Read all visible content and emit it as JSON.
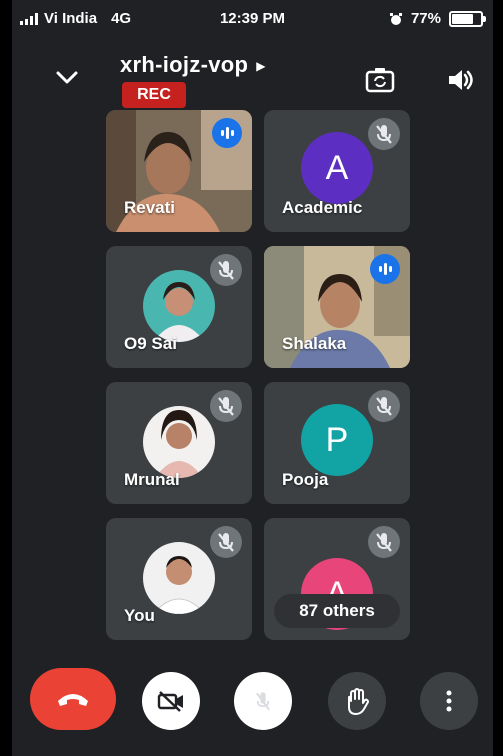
{
  "status_bar": {
    "carrier": "Vi India",
    "network": "4G",
    "time": "12:39 PM",
    "battery": "77%"
  },
  "meeting": {
    "code": "xrh-iojz-vop",
    "recording_label": "REC"
  },
  "participants": [
    {
      "name": "Revati",
      "tile": "video",
      "mic": "speaking"
    },
    {
      "name": "Academic",
      "tile": "avatar",
      "initial": "A",
      "avatar_color": "#5c2fc2",
      "mic": "muted"
    },
    {
      "name": "O9 Sai",
      "tile": "photo",
      "mic": "muted"
    },
    {
      "name": "Shalaka",
      "tile": "video",
      "mic": "speaking"
    },
    {
      "name": "Mrunal",
      "tile": "photo",
      "mic": "muted"
    },
    {
      "name": "Pooja",
      "tile": "avatar",
      "initial": "P",
      "avatar_color": "#12a4a4",
      "mic": "muted"
    },
    {
      "name": "You",
      "tile": "photo",
      "mic": "muted"
    },
    {
      "name": "87 others",
      "tile": "avatar",
      "initial": "A",
      "avatar_color": "#e8457a",
      "mic": "muted"
    }
  ],
  "controls": [
    {
      "icon": "end-call-icon",
      "color": "#ea4335"
    },
    {
      "icon": "camera-off-icon",
      "color": "#ffffff"
    },
    {
      "icon": "mic-off-icon",
      "color": "#ffffff"
    },
    {
      "icon": "raise-hand-icon",
      "color": "#3c4043"
    },
    {
      "icon": "more-vert-icon",
      "color": "#3c4043"
    }
  ]
}
